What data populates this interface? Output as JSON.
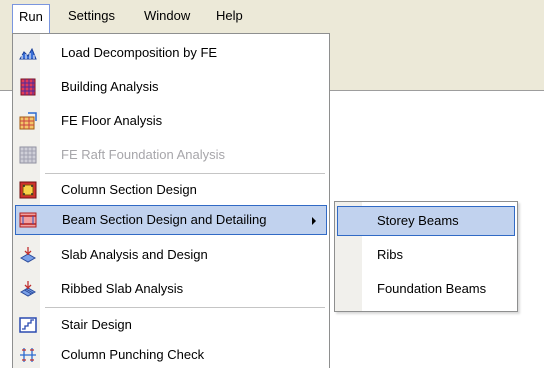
{
  "menubar": {
    "items": [
      {
        "label": "Run",
        "active": true
      },
      {
        "label": "Settings"
      },
      {
        "label": "Window"
      },
      {
        "label": "Help"
      }
    ]
  },
  "run_menu": {
    "items": [
      {
        "label": "Load Decomposition by FE",
        "icon": "load-decomposition-icon"
      },
      {
        "label": "Building Analysis",
        "icon": "building-grid-icon"
      },
      {
        "label": "FE Floor Analysis",
        "icon": "floor-analysis-icon"
      },
      {
        "label": "FE Raft Foundation Analysis",
        "icon": "raft-foundation-icon",
        "disabled": true
      },
      {
        "label": "Column Section Design",
        "icon": "column-section-icon"
      },
      {
        "label": "Beam Section Design and Detailing",
        "icon": "beam-section-icon",
        "highlighted": true,
        "has_submenu": true
      },
      {
        "label": "Slab Analysis and Design",
        "icon": "slab-analysis-icon"
      },
      {
        "label": "Ribbed Slab Analysis",
        "icon": "ribbed-slab-icon"
      },
      {
        "label": "Stair Design",
        "icon": "stair-design-icon"
      },
      {
        "label": "Column Punching Check",
        "icon": "punching-check-icon"
      }
    ]
  },
  "beam_submenu": {
    "items": [
      {
        "label": "Storey Beams",
        "highlighted": true
      },
      {
        "label": "Ribs"
      },
      {
        "label": "Foundation Beams"
      }
    ]
  },
  "colors": {
    "menu_bg": "#ece9d8",
    "highlight": "#c1d2ee",
    "highlight_border": "#316ac5",
    "disabled_text": "#a7a6aa"
  }
}
